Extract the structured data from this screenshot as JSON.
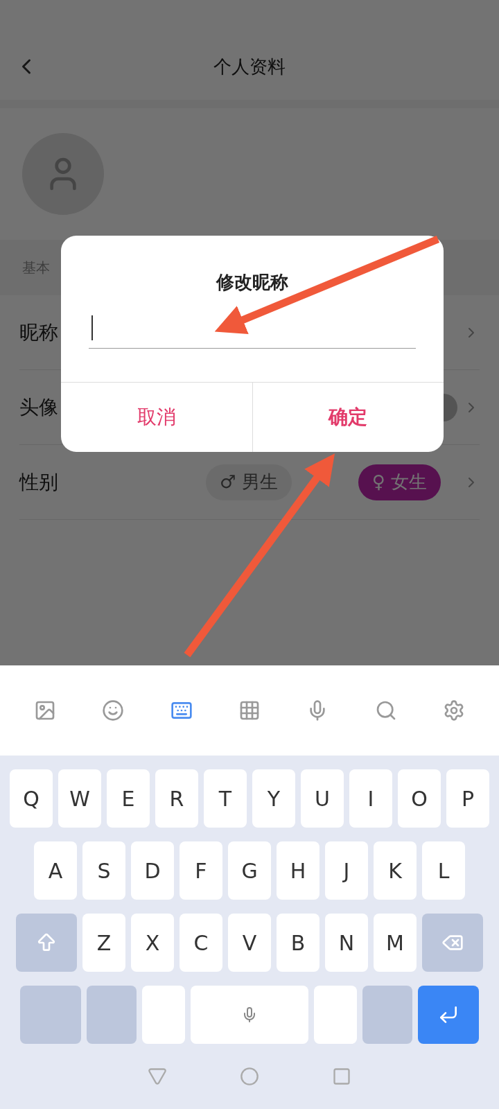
{
  "header": {
    "title": "个人资料"
  },
  "section": {
    "title": "基本"
  },
  "rows": [
    {
      "label": "昵称",
      "kind": "text"
    },
    {
      "label": "头像",
      "kind": "avatar"
    },
    {
      "label": "性别",
      "kind": "gender",
      "options": [
        {
          "label": "男生",
          "symbol": "♂",
          "selected": false
        },
        {
          "label": "女生",
          "symbol": "♀",
          "selected": true
        }
      ]
    }
  ],
  "dialog": {
    "title": "修改昵称",
    "buttons": [
      {
        "label": "取消",
        "kind": "cancel"
      },
      {
        "label": "确定",
        "kind": "confirm"
      }
    ]
  },
  "keyboard": {
    "rows": [
      [
        "Q",
        "W",
        "E",
        "R",
        "T",
        "Y",
        "U",
        "I",
        "O",
        "P"
      ],
      [
        "A",
        "S",
        "D",
        "F",
        "G",
        "H",
        "J",
        "K",
        "L"
      ],
      [
        "Z",
        "X",
        "C",
        "V",
        "B",
        "N",
        "M"
      ]
    ]
  }
}
